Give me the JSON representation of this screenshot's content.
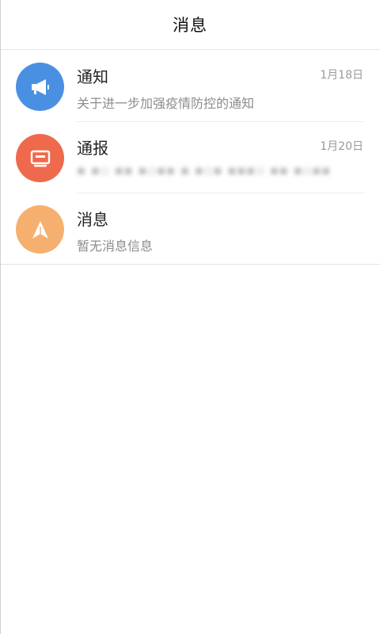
{
  "header": {
    "title": "消息"
  },
  "messages": [
    {
      "title": "通知",
      "date": "1月18日",
      "preview": "关于进一步加强疫情防控的通知",
      "icon": "megaphone-icon",
      "color": "#4a90e2"
    },
    {
      "title": "通报",
      "date": "1月20日",
      "preview": "",
      "icon": "monitor-icon",
      "color": "#ef6a4c"
    },
    {
      "title": "消息",
      "date": "",
      "preview": "暂无消息信息",
      "icon": "paper-plane-icon",
      "color": "#f5b06f"
    }
  ]
}
